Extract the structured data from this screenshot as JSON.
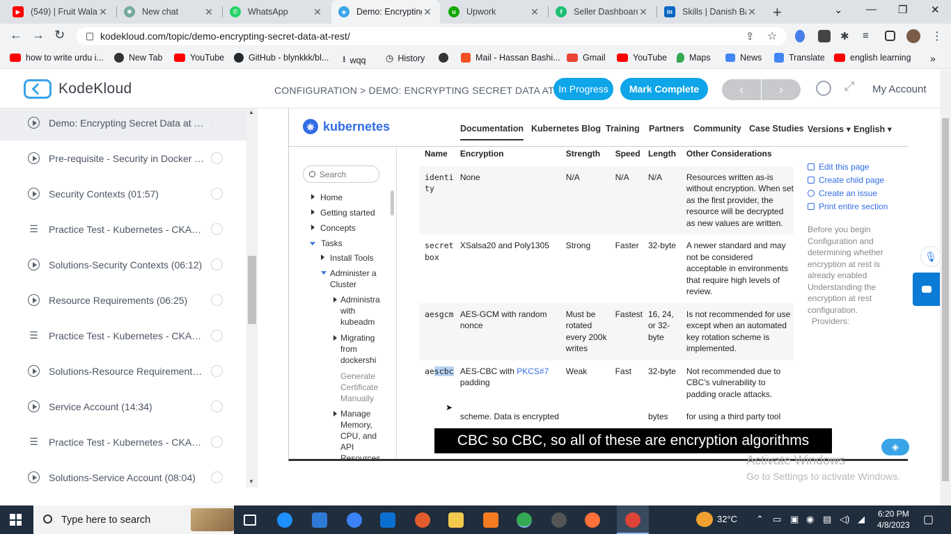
{
  "browser": {
    "tabs": [
      {
        "title": "(549) | Fruit Wala",
        "icon": "youtube-icon",
        "color": "#ff0000",
        "active": false
      },
      {
        "title": "New chat",
        "icon": "openai-icon",
        "color": "#74aa9c",
        "active": false
      },
      {
        "title": "WhatsApp",
        "icon": "whatsapp-icon",
        "color": "#25d366",
        "active": false
      },
      {
        "title": "Demo: Encrypting",
        "icon": "kodekloud-icon",
        "color": "#3aa4e8",
        "active": true
      },
      {
        "title": "Upwork",
        "icon": "upwork-icon",
        "color": "#14a800",
        "active": false
      },
      {
        "title": "Seller Dashboard",
        "icon": "fiverr-icon",
        "color": "#1dbf73",
        "active": false
      },
      {
        "title": "Skills | Danish Ba",
        "icon": "linkedin-icon",
        "color": "#0a66c2",
        "active": false
      }
    ],
    "url": "kodekloud.com/topic/demo-encrypting-secret-data-at-rest/",
    "bookmarks": [
      {
        "label": "how to write urdu i...",
        "color": "#ff0000"
      },
      {
        "label": "New Tab",
        "color": "#333333"
      },
      {
        "label": "YouTube",
        "color": "#ff0000"
      },
      {
        "label": "GitHub - blynkkk/bl...",
        "color": "#24292e"
      },
      {
        "label": "wqq",
        "color": "#444444"
      },
      {
        "label": "History",
        "color": "#444444"
      },
      {
        "label": "",
        "color": "#333333"
      },
      {
        "label": "Mail - Hassan Bashi...",
        "color": "#f25022"
      },
      {
        "label": "Gmail",
        "color": "#ea4335"
      },
      {
        "label": "YouTube",
        "color": "#ff0000"
      },
      {
        "label": "Maps",
        "color": "#34a853"
      },
      {
        "label": "News",
        "color": "#4285f4"
      },
      {
        "label": "Translate",
        "color": "#4285f4"
      },
      {
        "label": "english learning",
        "color": "#ff0000"
      }
    ]
  },
  "header": {
    "brand": "KodeKloud",
    "breadcrumb": "CONFIGURATION > DEMO: ENCRYPTING SECRET DATA AT ...",
    "status": "In Progress",
    "complete": "Mark Complete",
    "prev": "‹",
    "next": "›",
    "account": "My Account"
  },
  "lessons": [
    {
      "title": "Demo: Encrypting Secret Data at R...",
      "type": "video",
      "active": true
    },
    {
      "title": "Pre-requisite - Security in Docker (...",
      "type": "video",
      "active": false
    },
    {
      "title": "Security Contexts (01:57)",
      "type": "video",
      "active": false
    },
    {
      "title": "Practice Test - Kubernetes - CKAD ...",
      "type": "quiz",
      "active": false
    },
    {
      "title": "Solutions-Security Contexts (06:12)",
      "type": "video",
      "active": false
    },
    {
      "title": "Resource Requirements (06:25)",
      "type": "video",
      "active": false
    },
    {
      "title": "Practice Test - Kubernetes - CKAD ...",
      "type": "quiz",
      "active": false
    },
    {
      "title": "Solutions-Resource Requirements (...",
      "type": "video",
      "active": false
    },
    {
      "title": "Service Account (14:34)",
      "type": "video",
      "active": false
    },
    {
      "title": "Practice Test - Kubernetes - CKAD ...",
      "type": "quiz",
      "active": false
    },
    {
      "title": "Solutions-Service Account (08:04)",
      "type": "video",
      "active": false
    }
  ],
  "k8s": {
    "brand": "kubernetes",
    "nav": [
      "Documentation",
      "Kubernetes Blog",
      "Training",
      "Partners",
      "Community",
      "Case Studies",
      "Versions ▾",
      "English ▾"
    ],
    "search_placeholder": "Search",
    "tree": {
      "home": "Home",
      "getting_started": "Getting started",
      "concepts": "Concepts",
      "tasks": "Tasks",
      "install_tools": "Install Tools",
      "administer": "Administer a Cluster",
      "administration": "Administra with kubeadm",
      "migrating": "Migrating from dockershi",
      "generate": "Generate Certificate Manually",
      "manage": "Manage Memory, CPU, and API Resources"
    },
    "table": {
      "headers": [
        "Name",
        "Encryption",
        "Strength",
        "Speed",
        "Length",
        "Other Considerations"
      ],
      "rows": [
        {
          "name": "identity",
          "encryption": "None",
          "strength": "N/A",
          "speed": "N/A",
          "length": "N/A",
          "other": "Resources written as-is without encryption. When set as the first provider, the resource will be decrypted as new values are written."
        },
        {
          "name": "secretbox",
          "encryption": "XSalsa20 and Poly1305",
          "strength": "Strong",
          "speed": "Faster",
          "length": "32-byte",
          "other": "A newer standard and may not be considered acceptable in environments that require high levels of review."
        },
        {
          "name": "aesgcm",
          "encryption": "AES-GCM with random nonce",
          "strength": "Must be rotated every 200k writes",
          "speed": "Fastest",
          "length": "16, 24, or 32-byte",
          "other": "Is not recommended for use except when an automated key rotation scheme is implemented."
        },
        {
          "name_a": "ae",
          "name_b": "scbc",
          "encryption_a": "AES-CBC with ",
          "encryption_link": "PKCS#7",
          "encryption_b": " padding",
          "strength": "Weak",
          "speed": "Fast",
          "length": "32-byte",
          "other": "Not recommended due to CBC's vulnerability to padding oracle attacks."
        }
      ],
      "cut_encryption": "scheme. Data is encrypted",
      "cut_length": "bytes",
      "cut_other": "for using a third party tool"
    },
    "page_links": [
      "Edit this page",
      "Create child page",
      "Create an issue",
      "Print entire section"
    ],
    "toc": [
      "Before you begin",
      "Configuration and determining whether encryption at rest is already enabled",
      "Understanding the encryption at rest configuration.",
      "Providers:"
    ]
  },
  "video": {
    "caption": "CBC so CBC, so all of these are encryption algorithms",
    "watermark_title": "Activate Windows",
    "watermark_sub": "Go to Settings to activate Windows."
  },
  "taskbar": {
    "search_placeholder": "Type here to search",
    "weather": "32°C",
    "time": "6:20 PM",
    "date": "4/8/2023"
  }
}
